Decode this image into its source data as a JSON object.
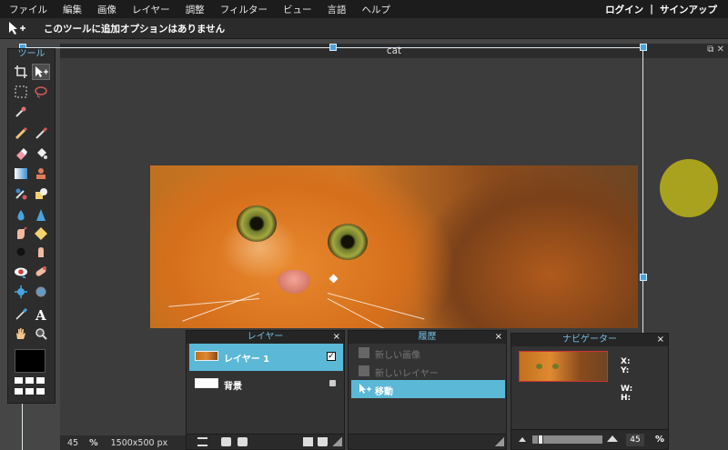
{
  "menu": {
    "items": [
      "ファイル",
      "編集",
      "画像",
      "レイヤー",
      "調整",
      "フィルター",
      "ビュー",
      "言語",
      "ヘルプ"
    ],
    "login": "ログイン",
    "separator": "|",
    "signup": "サインアップ"
  },
  "options_bar": {
    "tool_icon": "move-tool-icon",
    "message": "このツールに追加オプションはありません"
  },
  "canvas": {
    "title": "cat",
    "window_controls": "⧉ ✕",
    "zoom": "45",
    "zoom_unit": "%",
    "dimensions": "1500x500 px"
  },
  "tools": {
    "title": "ツール",
    "icons": [
      "crop-icon",
      "move-icon",
      "marquee-icon",
      "lasso-icon",
      "wand-icon",
      "pencil-icon",
      "brush-icon",
      "eraser-icon",
      "bucket-icon",
      "gradient-icon",
      "stamp-icon",
      "color-replace-icon",
      "shape-icon",
      "blur-icon",
      "sharpen-icon",
      "smudge-icon",
      "sponge-icon",
      "dodge-icon",
      "burn-icon",
      "redeye-icon",
      "spot-heal-icon",
      "bloat-icon",
      "pinch-icon",
      "picker-icon",
      "text-icon",
      "hand-icon",
      "zoom-icon"
    ],
    "foreground_color": "#000000"
  },
  "layers": {
    "title": "レイヤー",
    "close": "×",
    "items": [
      {
        "name": "レイヤー 1",
        "visible_check": "✓"
      },
      {
        "name": "背景"
      }
    ]
  },
  "history": {
    "title": "履歴",
    "close": "×",
    "items": [
      "新しい画像",
      "新しいレイヤー",
      "移動"
    ]
  },
  "navigator": {
    "title": "ナビゲーター",
    "close": "×",
    "x_label": "X:",
    "y_label": "Y:",
    "w_label": "W:",
    "h_label": "H:",
    "zoom": "45",
    "zoom_unit": "%",
    "slider_fraction": 0.08
  },
  "colors": {
    "accent": "#5bb8d6",
    "panel_title": "#72bfe3",
    "handle": "#4aa3df",
    "circle": "#a9a21e"
  }
}
